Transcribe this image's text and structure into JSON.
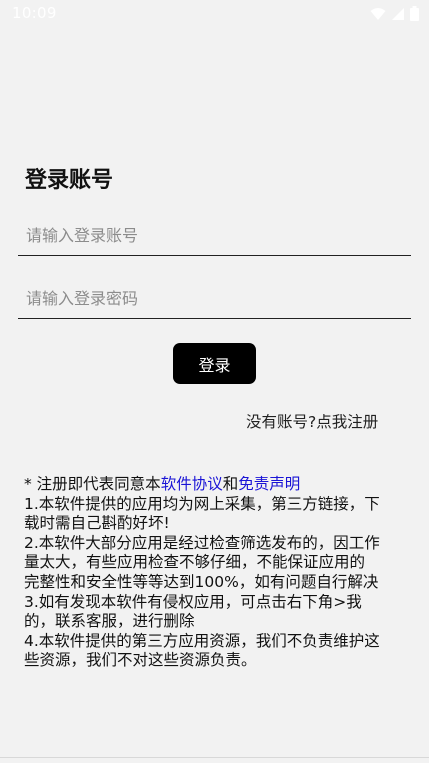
{
  "status_bar": {
    "time": "10:09",
    "icons": [
      "wifi-icon",
      "signal-icon",
      "battery-icon"
    ]
  },
  "login": {
    "title": "登录账号",
    "account_placeholder": "请输入登录账号",
    "password_placeholder": "请输入登录密码",
    "login_button": "登录",
    "register_link": "没有账号?点我注册"
  },
  "disclaimer": {
    "prefix": "* 注册即代表同意本",
    "software_agreement_link": "软件协议",
    "conjunction": "和",
    "disclaimer_link": "免责声明",
    "lines": [
      "1.本软件提供的应用均为网上采集，第三方链接，下",
      "载时需自己斟酌好坏!",
      "2.本软件大部分应用是经过检查筛选发布的，因工作",
      "量太大，有些应用检查不够仔细，不能保证应用的",
      "完整性和安全性等等达到100%，如有问题自行解决",
      "3.如有发现本软件有侵权应用，可点击右下角>我",
      "的，联系客服，进行删除",
      "4.本软件提供的第三方应用资源，我们不负责维护这",
      "些资源，我们不对这些资源负责。"
    ]
  },
  "colors": {
    "background": "#f2f2f2",
    "link": "#1a14d6",
    "button": "#000000"
  }
}
